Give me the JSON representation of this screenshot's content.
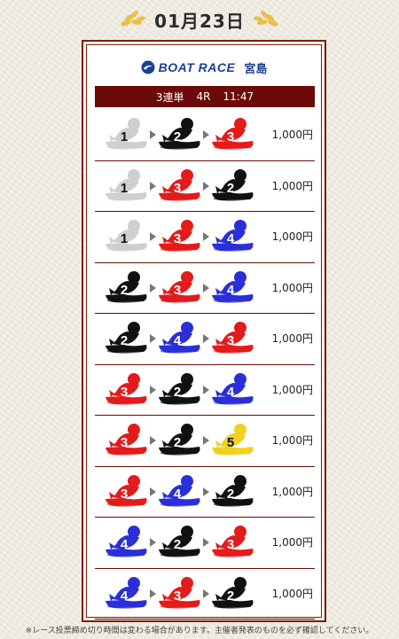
{
  "header": {
    "date": "01月23日",
    "laurel_color": "#e6c24a"
  },
  "logo": {
    "text": "BOAT RACE",
    "venue": "宮島",
    "color": "#1c3f93"
  },
  "race_bar": {
    "bet_type": "3連単",
    "race": "4R",
    "time": "11:47"
  },
  "boat_colors": {
    "1": {
      "fill": "#cfcfcf",
      "num": "#111111"
    },
    "2": {
      "fill": "#111111",
      "num": "#ffffff"
    },
    "3": {
      "fill": "#e31b1b",
      "num": "#ffffff"
    },
    "4": {
      "fill": "#2a2fd8",
      "num": "#ffffff"
    },
    "5": {
      "fill": "#f0d21e",
      "num": "#111111"
    }
  },
  "bets": [
    {
      "boats": [
        "1",
        "2",
        "3"
      ],
      "amount": "1,000円"
    },
    {
      "boats": [
        "1",
        "3",
        "2"
      ],
      "amount": "1,000円"
    },
    {
      "boats": [
        "1",
        "3",
        "4"
      ],
      "amount": "1,000円"
    },
    {
      "boats": [
        "2",
        "3",
        "4"
      ],
      "amount": "1,000円"
    },
    {
      "boats": [
        "2",
        "4",
        "3"
      ],
      "amount": "1,000円"
    },
    {
      "boats": [
        "3",
        "2",
        "4"
      ],
      "amount": "1,000円"
    },
    {
      "boats": [
        "3",
        "2",
        "5"
      ],
      "amount": "1,000円"
    },
    {
      "boats": [
        "3",
        "4",
        "2"
      ],
      "amount": "1,000円"
    },
    {
      "boats": [
        "4",
        "2",
        "3"
      ],
      "amount": "1,000円"
    },
    {
      "boats": [
        "4",
        "3",
        "2"
      ],
      "amount": "1,000円"
    }
  ],
  "footnote": "※レース投票締め切り時間は変わる場合があります。主催者発表のものを必ず確認してください。"
}
